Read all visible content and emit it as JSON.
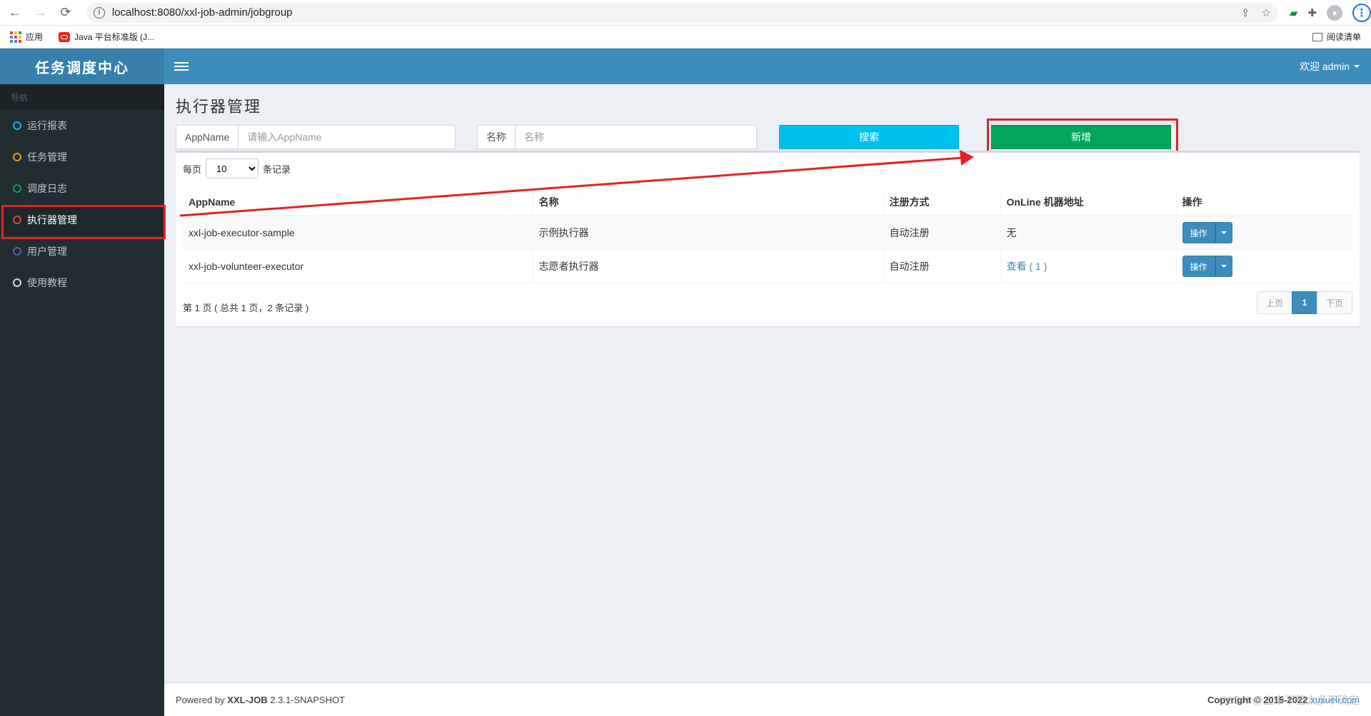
{
  "browser": {
    "back": "←",
    "forward": "→",
    "reload": "⟳",
    "url": "localhost:8080/xxl-job-admin/jobgroup",
    "bookmarks": {
      "apps": "应用",
      "java": "Java 平台标准版 (J..."
    },
    "reading_list": "阅读清单"
  },
  "app": {
    "title": "任务调度中心",
    "user_menu": "欢迎 admin"
  },
  "sidebar": {
    "header": "导航",
    "items": [
      {
        "label": "运行报表",
        "color": "#00c0ef"
      },
      {
        "label": "任务管理",
        "color": "#f39c12"
      },
      {
        "label": "调度日志",
        "color": "#00a65a"
      },
      {
        "label": "执行器管理",
        "color": "#dd4b39"
      },
      {
        "label": "用户管理",
        "color": "#605ca8"
      },
      {
        "label": "使用教程",
        "color": "#d2d6de"
      }
    ]
  },
  "page": {
    "title": "执行器管理",
    "search": {
      "appname_label": "AppName",
      "appname_placeholder": "请输入AppName",
      "name_label": "名称",
      "name_placeholder": "名称",
      "search_button": "搜索",
      "add_button": "新增"
    },
    "length": {
      "prefix": "每页",
      "value": "10",
      "suffix": "条记录"
    },
    "table": {
      "headers": [
        "AppName",
        "名称",
        "注册方式",
        "OnLine 机器地址",
        "操作"
      ],
      "rows": [
        {
          "appname": "xxl-job-executor-sample",
          "name": "示例执行器",
          "reg": "自动注册",
          "online": "无",
          "op": "操作"
        },
        {
          "appname": "xxl-job-volunteer-executor",
          "name": "志愿者执行器",
          "reg": "自动注册",
          "online": "查看 ( 1 )",
          "op": "操作"
        }
      ]
    },
    "info": "第 1 页 ( 总共 1 页，2 条记录 )",
    "pagination": {
      "prev": "上页",
      "current": "1",
      "next": "下页"
    }
  },
  "footer": {
    "powered": "Powered by",
    "brand": "XXL-JOB",
    "version": "2.3.1-SNAPSHOT",
    "copyright": "Copyright © 2015-2022",
    "link": "xuxueli.com"
  },
  "watermark": "CSDN @上帝不管太多不确定",
  "colors": {
    "header": "#3c8dbc",
    "sidebar": "#222d32",
    "search_btn": "#00c0ef",
    "add_btn": "#00a65a",
    "highlight": "#e02424"
  }
}
